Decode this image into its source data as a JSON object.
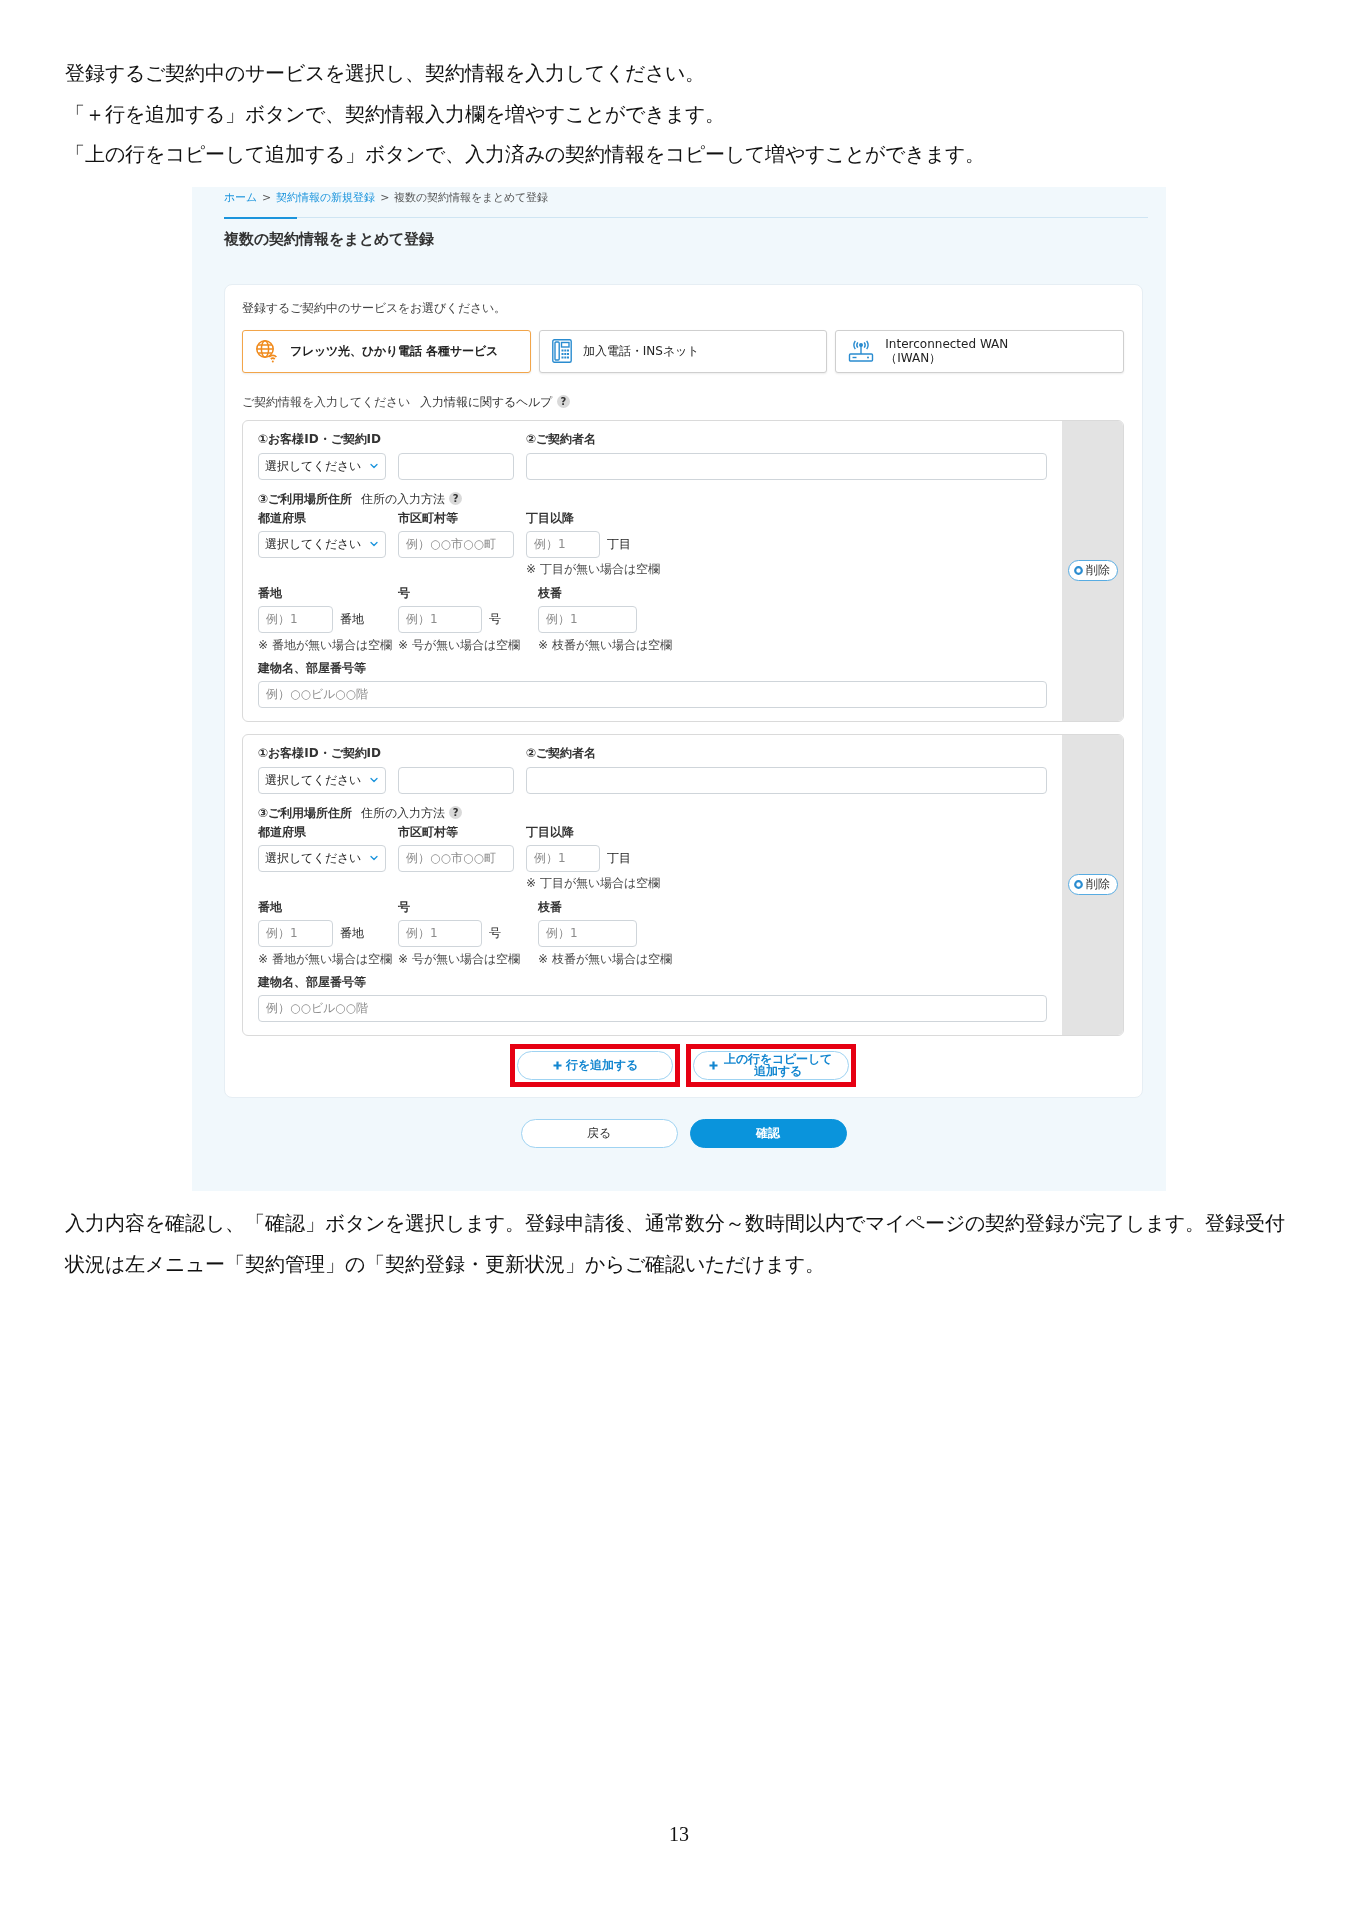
{
  "instructions": [
    "登録するご契約中のサービスを選択し、契約情報を入力してください。",
    "「＋行を追加する」ボタンで、契約情報入力欄を増やすことができます。",
    "「上の行をコピーして追加する」ボタンで、入力済みの契約情報をコピーして増やすことができます。"
  ],
  "screenshot": {
    "breadcrumb": [
      {
        "kind": "link",
        "label": "ホーム"
      },
      {
        "kind": "separator",
        "label": ">"
      },
      {
        "kind": "link",
        "label": "契約情報の新規登録"
      },
      {
        "kind": "separator",
        "label": ">"
      },
      {
        "kind": "current",
        "label": "複数の契約情報をまとめて登録"
      }
    ],
    "title": "複数の契約情報をまとめて登録",
    "service_prompt": "登録するご契約中のサービスをお選びください。",
    "services": [
      {
        "kind": "globe",
        "label": "フレッツ光、ひかり電話 各種サービス",
        "selected": true
      },
      {
        "kind": "phone",
        "label": "加入電話・INSネット",
        "selected": false
      },
      {
        "kind": "router",
        "label": "Interconnected WAN\n（IWAN）",
        "selected": false
      }
    ],
    "entry_prompt": "ご契約情報を入力してください",
    "help_link": "入力情報に関するヘルプ",
    "help_icon": "?",
    "entries": [
      {
        "id_label": "①お客様ID・ご契約ID",
        "id_type": "選択してください",
        "holder_label": "②ご契約者名",
        "address_heading": "③ご利用場所住所",
        "address_help": "住所の入力方法",
        "address_help_icon": "?",
        "prefecture_label": "都道府県",
        "prefecture": "選択してください",
        "city_label": "市区町村等",
        "city_placeholder": "例）○○市○○町",
        "chome_label": "丁目以降",
        "chome_placeholder": "例）1",
        "chome_unit": "丁目",
        "chome_note": "※ 丁目が無い場合は空欄",
        "banchi_label": "番地",
        "banchi_placeholder": "例）1",
        "banchi_unit": "番地",
        "banchi_note": "※ 番地が無い場合は空欄",
        "go_label": "号",
        "go_placeholder": "例）1",
        "go_unit": "号",
        "go_note": "※ 号が無い場合は空欄",
        "edaban_label": "枝番",
        "edaban_placeholder": "例）1",
        "edaban_note": "※ 枝番が無い場合は空欄",
        "building_label": "建物名、部屋番号等",
        "building_placeholder": "例）○○ビル○○階",
        "delete_button": "削除"
      },
      {
        "id_label": "①お客様ID・ご契約ID",
        "id_type": "選択してください",
        "holder_label": "②ご契約者名",
        "address_heading": "③ご利用場所住所",
        "address_help": "住所の入力方法",
        "address_help_icon": "?",
        "prefecture_label": "都道府県",
        "prefecture": "選択してください",
        "city_label": "市区町村等",
        "city_placeholder": "例）○○市○○町",
        "chome_label": "丁目以降",
        "chome_placeholder": "例）1",
        "chome_unit": "丁目",
        "chome_note": "※ 丁目が無い場合は空欄",
        "banchi_label": "番地",
        "banchi_placeholder": "例）1",
        "banchi_unit": "番地",
        "banchi_note": "※ 番地が無い場合は空欄",
        "go_label": "号",
        "go_placeholder": "例）1",
        "go_unit": "号",
        "go_note": "※ 号が無い場合は空欄",
        "edaban_label": "枝番",
        "edaban_placeholder": "例）1",
        "edaban_note": "※ 枝番が無い場合は空欄",
        "building_label": "建物名、部屋番号等",
        "building_placeholder": "例）○○ビル○○階",
        "delete_button": "削除"
      }
    ],
    "add_buttons": [
      {
        "kind": "add",
        "label": "行を追加する",
        "highlighted": true
      },
      {
        "kind": "copy",
        "label": "上の行をコピーして追加する",
        "highlighted": true
      }
    ],
    "footer_buttons": [
      {
        "kind": "secondary",
        "label": "戻る"
      },
      {
        "kind": "primary",
        "label": "確認"
      }
    ]
  },
  "closing": "入力内容を確認し、「確認」ボタンを選択します。登録申請後、通常数分～数時間以内でマイページの契約登録が完了します。登録受付状況は左メニュー「契約管理」の「契約登録・更新状況」からご確認いただけます。",
  "page_number": "13"
}
